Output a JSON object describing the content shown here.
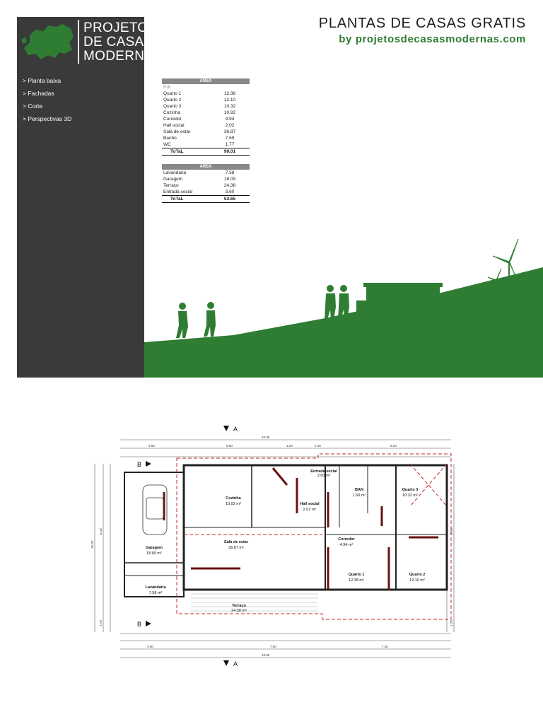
{
  "brand": {
    "name_lines": [
      "PROJETOS",
      "DE CASAS",
      "MODERNAS"
    ],
    "title": "PLANTAS DE CASAS GRATIS",
    "subtitle": "by projetosdecasasmodernas.com",
    "colors": {
      "green": "#2f7d32",
      "dark": "#3a3a3a"
    }
  },
  "menu": {
    "items": [
      "> Planta baixa",
      "> Fachadas",
      "> Corte",
      "> Perspectivas 3D"
    ]
  },
  "area_table_1": {
    "header": "AREA",
    "sublabel": "Rdc",
    "rows": [
      {
        "label": "Quarto 1",
        "value": "12.38"
      },
      {
        "label": "Quarto 2",
        "value": "12.10"
      },
      {
        "label": "Quarto 3",
        "value": "10.32"
      },
      {
        "label": "Cozinha",
        "value": "10.92"
      },
      {
        "label": "Corredor",
        "value": "4.94"
      },
      {
        "label": "Hall social",
        "value": "2.02"
      },
      {
        "label": "Sala de estar",
        "value": "36.87"
      },
      {
        "label": "Banho",
        "value": "7.69"
      },
      {
        "label": "WC",
        "value": "1.77"
      }
    ],
    "total_label": "ToTaL",
    "total_value": "99.01"
  },
  "area_table_2": {
    "header": "AREA",
    "rows": [
      {
        "label": "Lavandaria",
        "value": "7.58"
      },
      {
        "label": "Garagem",
        "value": "18.09"
      },
      {
        "label": "Terraço",
        "value": "24.38"
      },
      {
        "label": "Entrada social",
        "value": "3.60"
      }
    ],
    "total_label": "ToTaL",
    "total_value": "53.65"
  },
  "floor_plan": {
    "rooms": [
      {
        "name": "Cozinha",
        "area": "10.92 m²"
      },
      {
        "name": "Hall social",
        "area": "2.02 m²"
      },
      {
        "name": "Entrada social",
        "area": "3.60 m²"
      },
      {
        "name": "BAN",
        "area": "1.69 m²"
      },
      {
        "name": "Quarto 3",
        "area": "10.32 m²"
      },
      {
        "name": "Sala de estar",
        "area": "36.87 m²"
      },
      {
        "name": "Corredor",
        "area": "4.94 m²"
      },
      {
        "name": "Garagem",
        "area": "18.09 m²"
      },
      {
        "name": "Quarto 1",
        "area": "12.38 m²"
      },
      {
        "name": "Quarto 2",
        "area": "12.10 m²"
      },
      {
        "name": "Lavandaria",
        "area": "7.58 m²"
      },
      {
        "name": "Terraço",
        "area": "24.38 m²"
      }
    ],
    "section_a": "A",
    "section_b": "B",
    "top_dims": [
      "18.90",
      "3.60",
      "5.50",
      "1.20",
      "2.40",
      "6.20"
    ],
    "bottom_dims": [
      "3.60",
      "7.90",
      "7.20",
      "18.90"
    ],
    "left_dims": [
      "10.20",
      "6.10",
      "1.70"
    ],
    "right_dims": [
      "8.50",
      "1.70"
    ]
  }
}
